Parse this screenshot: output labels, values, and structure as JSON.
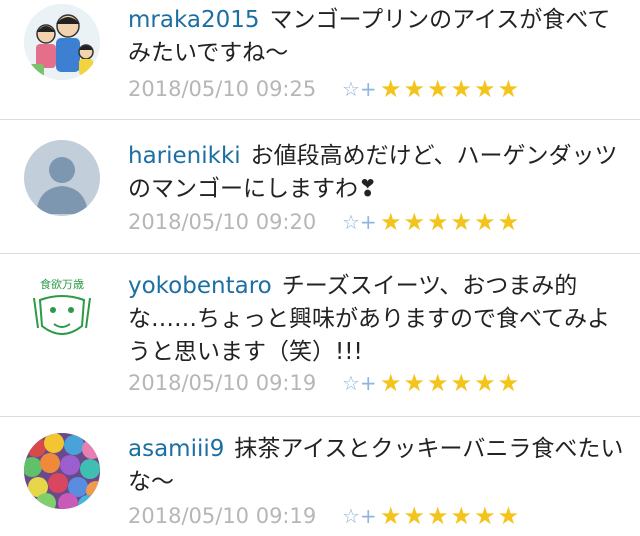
{
  "comments": [
    {
      "username": "mraka2015",
      "text": "マンゴープリンのアイスが食べてみたいですね〜",
      "timestamp": "2018/05/10 09:25",
      "star_add_icon": "☆+",
      "stars": "★★★★★★",
      "avatar": "cartoon-family-avatar"
    },
    {
      "username": "harienikki",
      "text": "お値段高めだけど、ハーゲンダッツのマンゴーにしますわ❣",
      "timestamp": "2018/05/10 09:20",
      "star_add_icon": "☆+",
      "stars": "★★★★★★",
      "avatar": "default-user-avatar"
    },
    {
      "username": "yokobentaro",
      "text": "チーズスイーツ、おつまみ的な……ちょっと興味がありますので食べてみようと思います（笑）!!!",
      "timestamp": "2018/05/10 09:19",
      "star_add_icon": "☆+",
      "stars": "★★★★★★",
      "avatar": "green-face-stamp-avatar",
      "avatar_text": "食欲万歳"
    },
    {
      "username": "asamiii9",
      "text": "抹茶アイスとクッキーバニラ食べたいな〜",
      "timestamp": "2018/05/10 09:19",
      "star_add_icon": "☆+",
      "stars": "★★★★★★",
      "avatar": "pompom-photo-avatar"
    }
  ]
}
